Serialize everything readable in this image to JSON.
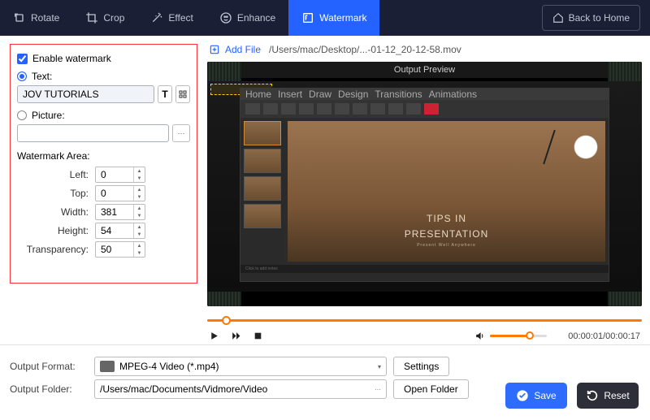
{
  "toolbar": {
    "rotate": "Rotate",
    "crop": "Crop",
    "effect": "Effect",
    "enhance": "Enhance",
    "watermark": "Watermark",
    "back_home": "Back to Home"
  },
  "watermark_panel": {
    "enable_label": "Enable watermark",
    "text_label": "Text:",
    "text_value": "JOV TUTORIALS",
    "picture_label": "Picture:",
    "area_label": "Watermark Area:",
    "left_label": "Left:",
    "left_value": "0",
    "top_label": "Top:",
    "top_value": "0",
    "width_label": "Width:",
    "width_value": "381",
    "height_label": "Height:",
    "height_value": "54",
    "transparency_label": "Transparency:",
    "transparency_value": "50"
  },
  "preview": {
    "add_file": "Add File",
    "file_path": "/Users/mac/Desktop/...-01-12_20-12-58.mov",
    "title": "Output Preview",
    "slide_title": "TIPS IN",
    "slide_title2": "PRESENTATION",
    "slide_sub": "Present Well Anywhere",
    "notes": "Click to add notes",
    "time": "00:00:01/00:00:17"
  },
  "output": {
    "format_label": "Output Format:",
    "format_value": "MPEG-4 Video (*.mp4)",
    "settings": "Settings",
    "folder_label": "Output Folder:",
    "folder_value": "/Users/mac/Documents/Vidmore/Video",
    "open_folder": "Open Folder",
    "save": "Save",
    "reset": "Reset"
  }
}
